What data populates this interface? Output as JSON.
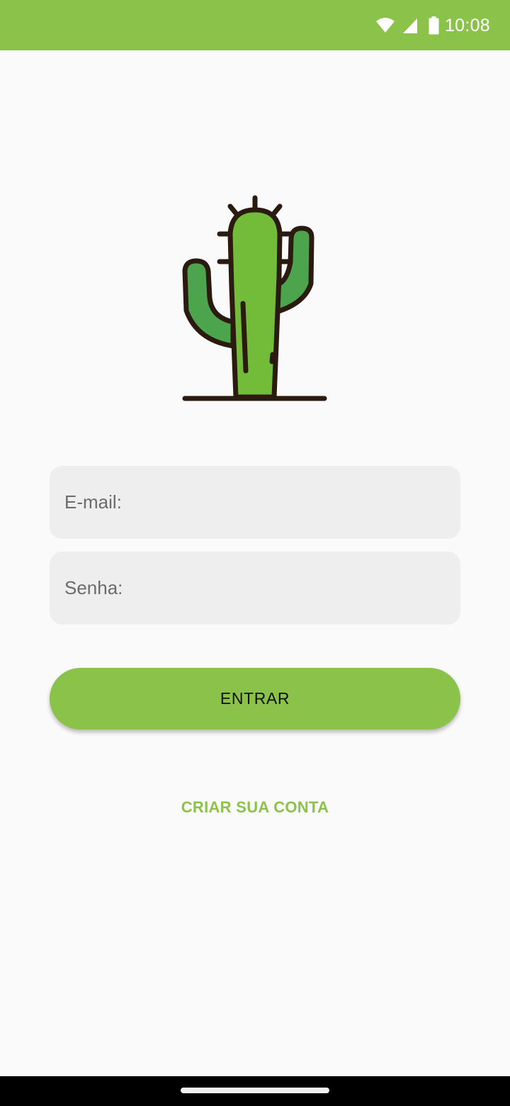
{
  "status_bar": {
    "time": "10:08",
    "icons": [
      "wifi-icon",
      "cellular-signal-icon",
      "battery-icon"
    ],
    "background": "#8bc34a"
  },
  "logo": {
    "icon": "cactus-icon"
  },
  "form": {
    "email_placeholder": "E-mail:",
    "email_value": "",
    "password_placeholder": "Senha:",
    "password_value": "",
    "submit_label": "ENTRAR",
    "create_account_label": "CRIAR SUA CONTA"
  },
  "colors": {
    "primary": "#8bc34a",
    "field_background": "#eeeeee",
    "page_background": "#fafafa",
    "cactus_green": "#72bc3a",
    "cactus_arm_green": "#4ca54c",
    "outline": "#2a1a10"
  }
}
